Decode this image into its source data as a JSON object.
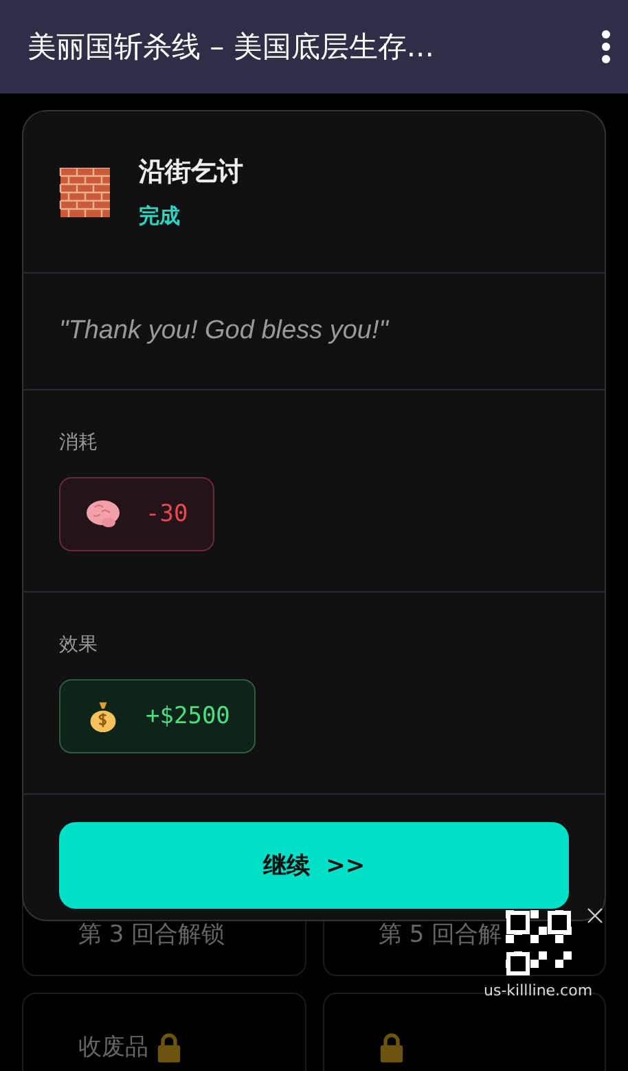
{
  "app_bar": {
    "title": "美丽国斩杀线 – 美国底层生存..."
  },
  "background_cards": [
    {
      "text": "第 3 回合解锁",
      "locked": false
    },
    {
      "text": "第 5 回合解",
      "locked": false
    },
    {
      "text": "收废品",
      "locked": true
    },
    {
      "locked": true
    }
  ],
  "dialog": {
    "title": "沿街乞讨",
    "status": "完成",
    "quote": "\"Thank you! God bless you!\"",
    "sections": [
      {
        "label": "消耗",
        "kind": "cost",
        "items": [
          {
            "kind": "brain",
            "value": "-30"
          }
        ]
      },
      {
        "label": "效果",
        "kind": "gain",
        "items": [
          {
            "kind": "money",
            "value": "+$2500"
          }
        ]
      }
    ],
    "button": "继续  >>"
  },
  "qr_popup": {
    "url": "us-killline.com"
  }
}
